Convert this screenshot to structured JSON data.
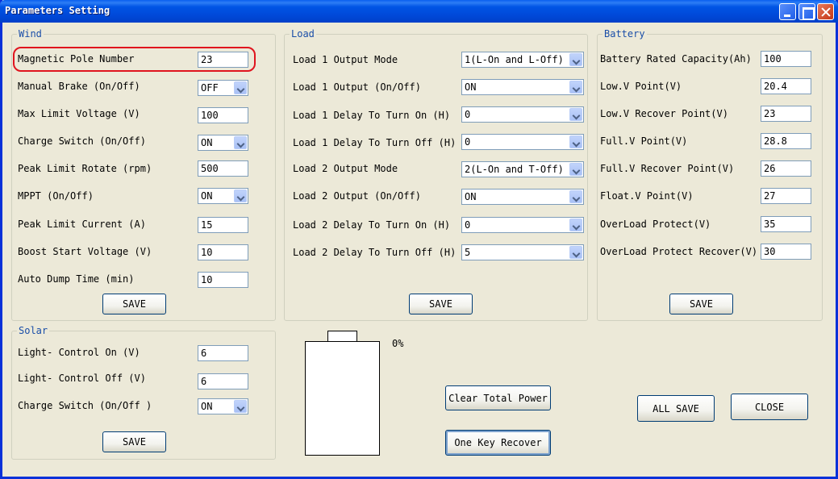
{
  "window": {
    "title": "Parameters Setting"
  },
  "wind": {
    "title": "Wind",
    "fields": {
      "magnetic_pole_number": {
        "label": "Magnetic Pole Number",
        "value": "23"
      },
      "manual_brake": {
        "label": "Manual Brake (On/Off)",
        "value": "OFF"
      },
      "max_limit_voltage": {
        "label": "Max Limit Voltage (V)",
        "value": "100"
      },
      "charge_switch": {
        "label": "Charge Switch (On/Off)",
        "value": "ON"
      },
      "peak_limit_rotate": {
        "label": "Peak Limit Rotate (rpm)",
        "value": "500"
      },
      "mppt": {
        "label": "MPPT (On/Off)",
        "value": "ON"
      },
      "peak_limit_current": {
        "label": "Peak Limit Current (A)",
        "value": "15"
      },
      "boost_start_voltage": {
        "label": "Boost Start Voltage (V)",
        "value": "10"
      },
      "auto_dump_time": {
        "label": "Auto Dump Time (min)",
        "value": "10"
      }
    },
    "save_label": "SAVE"
  },
  "load": {
    "title": "Load",
    "fields": {
      "load1_output_mode": {
        "label": "Load 1 Output Mode",
        "value": "1(L-On and L-Off)"
      },
      "load1_output": {
        "label": "Load 1 Output (On/Off)",
        "value": "ON"
      },
      "load1_delay_on": {
        "label": "Load 1 Delay To Turn On (H)",
        "value": "0"
      },
      "load1_delay_off": {
        "label": "Load 1 Delay To Turn Off (H)",
        "value": "0"
      },
      "load2_output_mode": {
        "label": "Load 2 Output Mode",
        "value": "2(L-On and T-Off)"
      },
      "load2_output": {
        "label": "Load 2 Output (On/Off)",
        "value": "ON"
      },
      "load2_delay_on": {
        "label": "Load 2 Delay To Turn On (H)",
        "value": "0"
      },
      "load2_delay_off": {
        "label": "Load 2 Delay To Turn Off (H)",
        "value": "5"
      }
    },
    "save_label": "SAVE"
  },
  "battery": {
    "title": "Battery",
    "fields": {
      "rated_capacity": {
        "label": "Battery Rated Capacity(Ah)",
        "value": "100"
      },
      "low_v_point": {
        "label": "Low.V Point(V)",
        "value": "20.4"
      },
      "low_v_recover": {
        "label": "Low.V Recover Point(V)",
        "value": "23"
      },
      "full_v_point": {
        "label": "Full.V Point(V)",
        "value": "28.8"
      },
      "full_v_recover": {
        "label": "Full.V Recover Point(V)",
        "value": "26"
      },
      "float_v_point": {
        "label": "Float.V Point(V)",
        "value": "27"
      },
      "overload_protect": {
        "label": "OverLoad Protect(V)",
        "value": "35"
      },
      "overload_protect_recover": {
        "label": "OverLoad Protect Recover(V)",
        "value": "30"
      }
    },
    "save_label": "SAVE"
  },
  "solar": {
    "title": "Solar",
    "fields": {
      "light_control_on": {
        "label": "Light- Control On (V)",
        "value": "6"
      },
      "light_control_off": {
        "label": "Light- Control Off (V)",
        "value": "6"
      },
      "charge_switch": {
        "label": "Charge Switch (On/Off )",
        "value": "ON"
      }
    },
    "save_label": "SAVE"
  },
  "battery_indicator": {
    "percent_label": "0%",
    "level": 0
  },
  "actions": {
    "clear_total_power": "Clear Total Power",
    "one_key_recover": "One Key Recover",
    "all_save": "ALL SAVE",
    "close": "CLOSE"
  }
}
